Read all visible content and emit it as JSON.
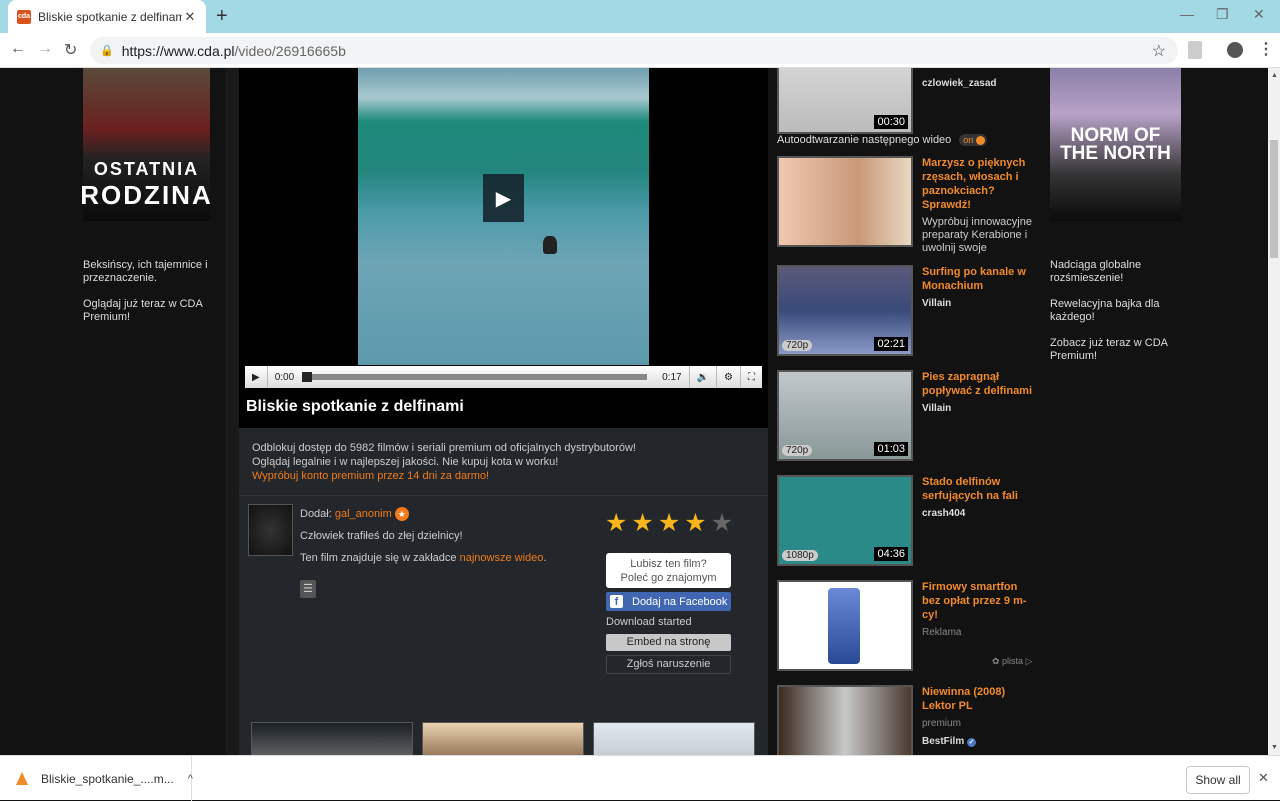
{
  "browser": {
    "tab_title": "Bliskie spotkanie z delfinami - wi",
    "favicon_label": "cda",
    "url_domain": "https://www.cda.pl",
    "url_path": "/video/26916665b"
  },
  "left_ad": {
    "poster_line1": "OSTATNIA",
    "poster_line2": "RODZINA",
    "text1": "Beksińscy, ich tajemnice i przeznaczenie.",
    "text2": "Oglądaj już teraz w CDA Premium!"
  },
  "player": {
    "current_time": "0:00",
    "duration": "0:17",
    "progress_fraction": 0.0
  },
  "video": {
    "title": "Bliskie spotkanie z delfinami",
    "promo_line1": "Odblokuj dostęp do 5982 filmów i seriali premium od oficjalnych dystrybutorów!",
    "promo_line2": "Oglądaj legalnie i w najlepszej jakości. Nie kupuj kota w worku!",
    "promo_link": "Wypróbuj konto premium przez 14 dni za darmo!",
    "added_by_label": "Dodał:",
    "uploader": "gal_anonim",
    "description": "Człowiek trafiłeś do złej dzielnicy!",
    "category_prefix": "Ten film znajduje się w zakładce",
    "category_link": "najnowsze wideo",
    "category_suffix": ".",
    "rating_stars": 4,
    "rating_max": 5,
    "fb_prompt_line1": "Lubisz ten film?",
    "fb_prompt_line2": "Poleć go znajomym",
    "fb_button": "Dodaj na Facebook",
    "download_status": "Download started",
    "embed_button": "Embed na stronę",
    "report_button": "Zgłoś naruszenie"
  },
  "sidebar": {
    "autoplay_label": "Autoodtwarzanie następnego wideo",
    "autoplay_state": "on",
    "top_item": {
      "author": "czlowiek_zasad",
      "duration": "00:30"
    },
    "items": [
      {
        "title": "Marzysz o pięknych rzęsach, włosach i paznokciach? Sprawdź!",
        "desc": "Wypróbuj innowacyjne preparaty Kerabione i uwolnij swoje naturalne piękno"
      },
      {
        "title": "Surfing po kanale w Monachium",
        "author": "Villain",
        "quality": "720p",
        "duration": "02:21"
      },
      {
        "title": "Pies zapragnął popływać z delfinami",
        "author": "Villain",
        "quality": "720p",
        "duration": "01:03"
      },
      {
        "title": "Stado delfinów serfujących na fali",
        "author": "crash404",
        "quality": "1080p",
        "duration": "04:36"
      },
      {
        "title": "Firmowy smartfon bez opłat przez 9 m-cy!",
        "label": "Reklama"
      },
      {
        "title": "Niewinna (2008) Lektor PL",
        "label": "premium",
        "author": "BestFilm"
      }
    ],
    "plista_label": "plista"
  },
  "right_ad": {
    "poster_title": "NORM OF THE NORTH",
    "text1": "Nadciąga globalne rozśmieszenie!",
    "text2": "Rewelacyjna bajka dla każdego!",
    "text3": "Zobacz już teraz w CDA Premium!"
  },
  "downloads": {
    "filename": "Bliskie_spotkanie_....m...",
    "show_all": "Show all"
  }
}
